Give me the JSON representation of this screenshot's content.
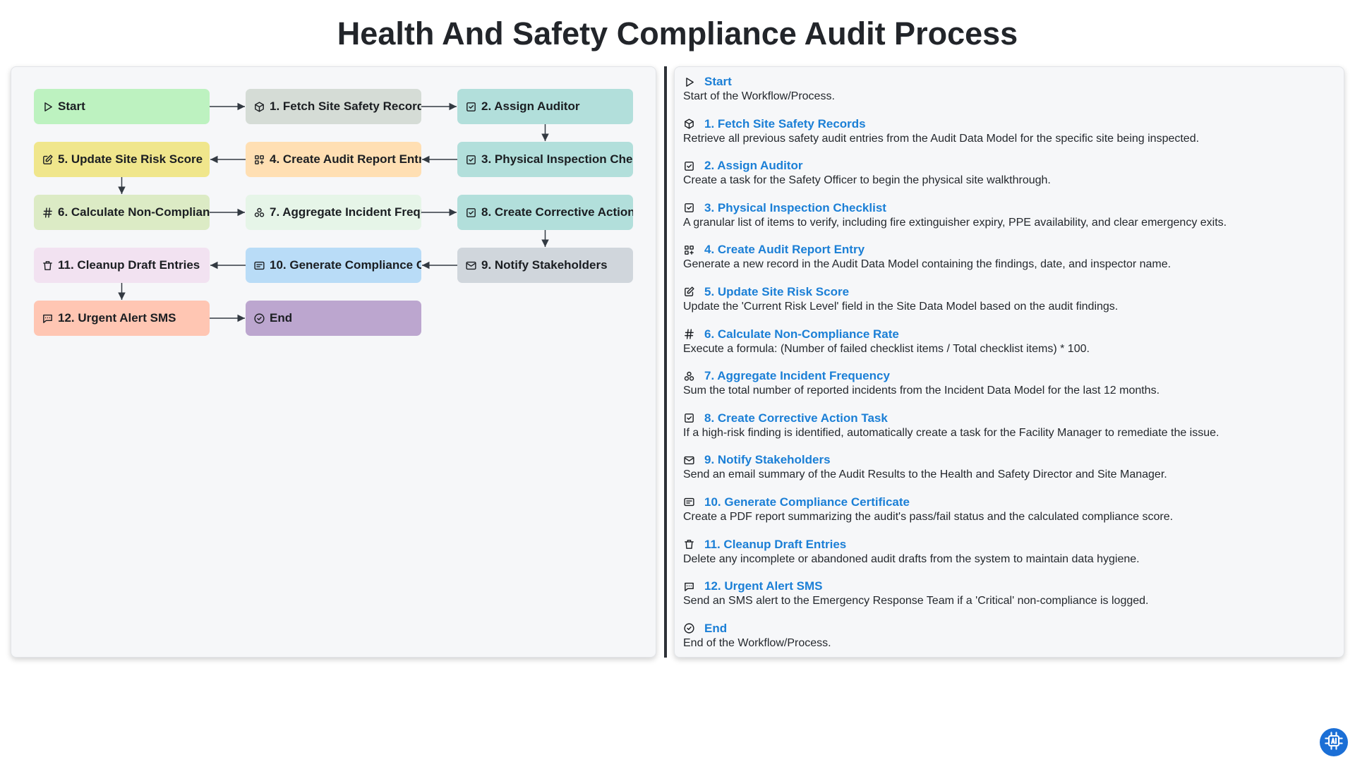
{
  "title": "Health And Safety Compliance Audit Process",
  "colors": {
    "accent": "#1b7fd6",
    "start": "#bdf2c0",
    "fetch": "#d5dcd6",
    "teal": "#b2dfdb",
    "create_entry": "#ffdfb3",
    "update_score": "#f0e68c",
    "calculate": "#dcebc5",
    "aggregate": "#e6f5e8",
    "notify": "#d0d6dc",
    "generate": "#b9dcf7",
    "cleanup": "#f2e2f1",
    "urgent": "#ffc6b3",
    "end": "#bca6cf"
  },
  "nodes": [
    {
      "id": "start",
      "label": "Start",
      "icon": "play-icon",
      "color": "#bdf2c0"
    },
    {
      "id": "n1",
      "label": "1. Fetch Site Safety Records",
      "icon": "cube-icon",
      "color": "#d5dcd6"
    },
    {
      "id": "n2",
      "label": "2. Assign Auditor",
      "icon": "checkbox-icon",
      "color": "#b2dfdb"
    },
    {
      "id": "n3",
      "label": "3. Physical Inspection Checklist",
      "icon": "checkbox-icon",
      "color": "#b2dfdb"
    },
    {
      "id": "n4",
      "label": "4. Create Audit Report Entry",
      "icon": "grid-plus-icon",
      "color": "#ffdfb3"
    },
    {
      "id": "n5",
      "label": "5. Update Site Risk Score",
      "icon": "edit-icon",
      "color": "#f0e68c"
    },
    {
      "id": "n6",
      "label": "6. Calculate Non-Compliance Rate",
      "icon": "hash-icon",
      "color": "#dcebc5"
    },
    {
      "id": "n7",
      "label": "7. Aggregate Incident Frequency",
      "icon": "circles-icon",
      "color": "#e6f5e8"
    },
    {
      "id": "n8",
      "label": "8. Create Corrective Action Task",
      "icon": "checkbox-icon",
      "color": "#b2dfdb"
    },
    {
      "id": "n9",
      "label": "9. Notify Stakeholders",
      "icon": "mail-icon",
      "color": "#d0d6dc"
    },
    {
      "id": "n10",
      "label": "10. Generate Compliance Certificate",
      "icon": "certificate-icon",
      "color": "#b9dcf7"
    },
    {
      "id": "n11",
      "label": "11. Cleanup Draft Entries",
      "icon": "trash-icon",
      "color": "#f2e2f1"
    },
    {
      "id": "n12",
      "label": "12. Urgent Alert SMS",
      "icon": "message-icon",
      "color": "#ffc6b3"
    },
    {
      "id": "end",
      "label": "End",
      "icon": "check-circle-icon",
      "color": "#bca6cf"
    }
  ],
  "edges": [
    [
      "start",
      "n1"
    ],
    [
      "n1",
      "n2"
    ],
    [
      "n2",
      "n3"
    ],
    [
      "n3",
      "n4"
    ],
    [
      "n4",
      "n5"
    ],
    [
      "n5",
      "n6"
    ],
    [
      "n6",
      "n7"
    ],
    [
      "n7",
      "n8"
    ],
    [
      "n8",
      "n9"
    ],
    [
      "n9",
      "n10"
    ],
    [
      "n10",
      "n11"
    ],
    [
      "n11",
      "n12"
    ],
    [
      "n12",
      "end"
    ]
  ],
  "descriptions": [
    {
      "title": "Start",
      "icon": "play-icon",
      "text": "Start of the Workflow/Process."
    },
    {
      "title": "1. Fetch Site Safety Records",
      "icon": "cube-icon",
      "text": "Retrieve all previous safety audit entries from the Audit Data Model for the specific site being inspected."
    },
    {
      "title": "2. Assign Auditor",
      "icon": "checkbox-icon",
      "text": "Create a task for the Safety Officer to begin the physical site walkthrough."
    },
    {
      "title": "3. Physical Inspection Checklist",
      "icon": "checkbox-icon",
      "text": "A granular list of items to verify, including fire extinguisher expiry, PPE availability, and clear emergency exits."
    },
    {
      "title": "4. Create Audit Report Entry",
      "icon": "grid-plus-icon",
      "text": "Generate a new record in the Audit Data Model containing the findings, date, and inspector name."
    },
    {
      "title": "5. Update Site Risk Score",
      "icon": "edit-icon",
      "text": "Update the 'Current Risk Level' field in the Site Data Model based on the audit findings."
    },
    {
      "title": "6. Calculate Non-Compliance Rate",
      "icon": "hash-icon",
      "text": "Execute a formula: (Number of failed checklist items / Total checklist items) * 100."
    },
    {
      "title": "7. Aggregate Incident Frequency",
      "icon": "circles-icon",
      "text": "Sum the total number of reported incidents from the Incident Data Model for the last 12 months."
    },
    {
      "title": "8. Create Corrective Action Task",
      "icon": "checkbox-icon",
      "text": "If a high-risk finding is identified, automatically create a task for the Facility Manager to remediate the issue."
    },
    {
      "title": "9. Notify Stakeholders",
      "icon": "mail-icon",
      "text": "Send an email summary of the Audit Results to the Health and Safety Director and Site Manager."
    },
    {
      "title": "10. Generate Compliance Certificate",
      "icon": "certificate-icon",
      "text": "Create a PDF report summarizing the audit's pass/fail status and the calculated compliance score."
    },
    {
      "title": "11. Cleanup Draft Entries",
      "icon": "trash-icon",
      "text": "Delete any incomplete or abandoned audit drafts from the system to maintain data hygiene."
    },
    {
      "title": "12. Urgent Alert SMS",
      "icon": "message-icon",
      "text": "Send an SMS alert to the Emergency Response Team if a 'Critical' non-compliance is logged."
    },
    {
      "title": "End",
      "icon": "check-circle-icon",
      "text": "End of the Workflow/Process."
    }
  ],
  "badge": {
    "icon": "ai-chip-icon"
  }
}
